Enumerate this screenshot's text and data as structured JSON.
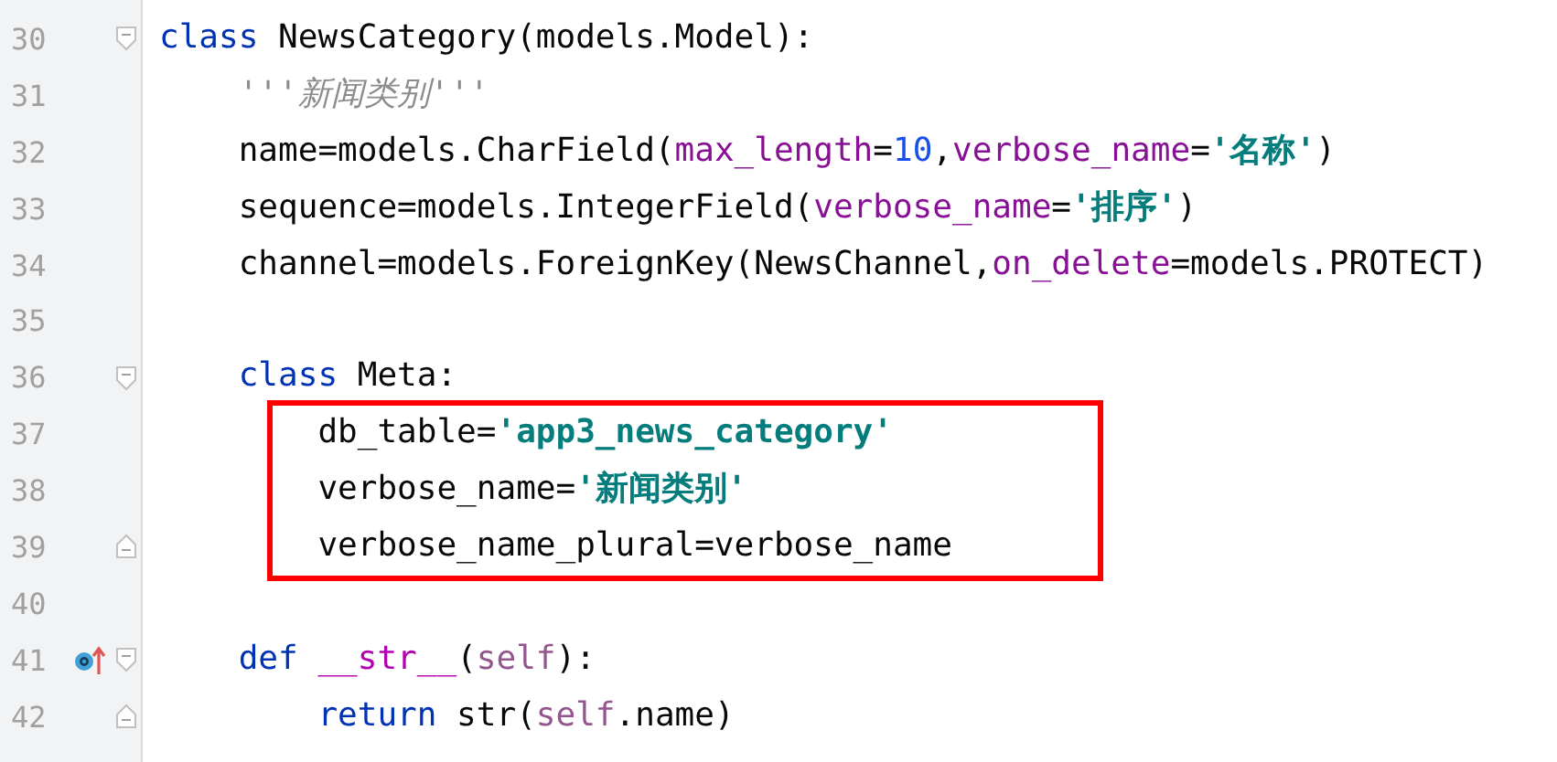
{
  "editor": {
    "lines": [
      {
        "kind": "line",
        "number": "30",
        "fold": {
          "kind": "start"
        },
        "tokens": [
          {
            "kind": "keyword",
            "text": "class"
          },
          {
            "kind": "plain",
            "text": " NewsCategory(models.Model):"
          }
        ]
      },
      {
        "kind": "line",
        "number": "31",
        "tokens": [
          {
            "kind": "doc",
            "text": "    '''新闻类别'''"
          }
        ]
      },
      {
        "kind": "line",
        "number": "32",
        "tokens": [
          {
            "kind": "plain",
            "text": "    name=models.CharField("
          },
          {
            "kind": "param",
            "text": "max_length"
          },
          {
            "kind": "plain",
            "text": "="
          },
          {
            "kind": "number",
            "text": "10"
          },
          {
            "kind": "plain",
            "text": ","
          },
          {
            "kind": "param",
            "text": "verbose_name"
          },
          {
            "kind": "plain",
            "text": "="
          },
          {
            "kind": "string",
            "text": "'名称'"
          },
          {
            "kind": "plain",
            "text": ")"
          }
        ]
      },
      {
        "kind": "line",
        "number": "33",
        "tokens": [
          {
            "kind": "plain",
            "text": "    sequence=models.IntegerField("
          },
          {
            "kind": "param",
            "text": "verbose_name"
          },
          {
            "kind": "plain",
            "text": "="
          },
          {
            "kind": "string",
            "text": "'排序'"
          },
          {
            "kind": "plain",
            "text": ")"
          }
        ]
      },
      {
        "kind": "line",
        "number": "34",
        "tokens": [
          {
            "kind": "plain",
            "text": "    channel=models.ForeignKey(NewsChannel,"
          },
          {
            "kind": "param",
            "text": "on_delete"
          },
          {
            "kind": "plain",
            "text": "=models.PROTECT)"
          }
        ]
      },
      {
        "kind": "line",
        "number": "35"
      },
      {
        "kind": "line",
        "number": "36",
        "fold": {
          "kind": "start"
        },
        "tokens": [
          {
            "kind": "keyword",
            "text": "    class"
          },
          {
            "kind": "plain",
            "text": " Meta:"
          }
        ]
      },
      {
        "kind": "frame",
        "lines": [
          {
            "kind": "line",
            "number": "37",
            "tokens": [
              {
                "kind": "plain",
                "text": "        db_table="
              },
              {
                "kind": "string",
                "text": "'app3_news_category'"
              }
            ]
          },
          {
            "kind": "line",
            "number": "38",
            "tokens": [
              {
                "kind": "plain",
                "text": "        verbose_name="
              },
              {
                "kind": "string",
                "text": "'新闻类别'"
              }
            ]
          },
          {
            "kind": "line",
            "number": "39",
            "fold": {
              "kind": "end"
            },
            "tokens": [
              {
                "kind": "plain",
                "text": "        verbose_name_plural=verbose_name"
              }
            ]
          }
        ]
      },
      {
        "kind": "line",
        "number": "40"
      },
      {
        "kind": "line",
        "number": "41",
        "fold": {
          "kind": "start"
        },
        "gutter_icon": {
          "kind": "override"
        },
        "tokens": [
          {
            "kind": "keyword",
            "text": "    def"
          },
          {
            "kind": "dunder",
            "text": " __str__"
          },
          {
            "kind": "plain",
            "text": "("
          },
          {
            "kind": "self",
            "text": "self"
          },
          {
            "kind": "plain",
            "text": "):"
          }
        ]
      },
      {
        "kind": "line",
        "number": "42",
        "fold": {
          "kind": "end"
        },
        "tokens": [
          {
            "kind": "keyword",
            "text": "        return"
          },
          {
            "kind": "plain",
            "text": " str("
          },
          {
            "kind": "self",
            "text": "self"
          },
          {
            "kind": "plain",
            "text": ".name)"
          }
        ]
      }
    ]
  }
}
